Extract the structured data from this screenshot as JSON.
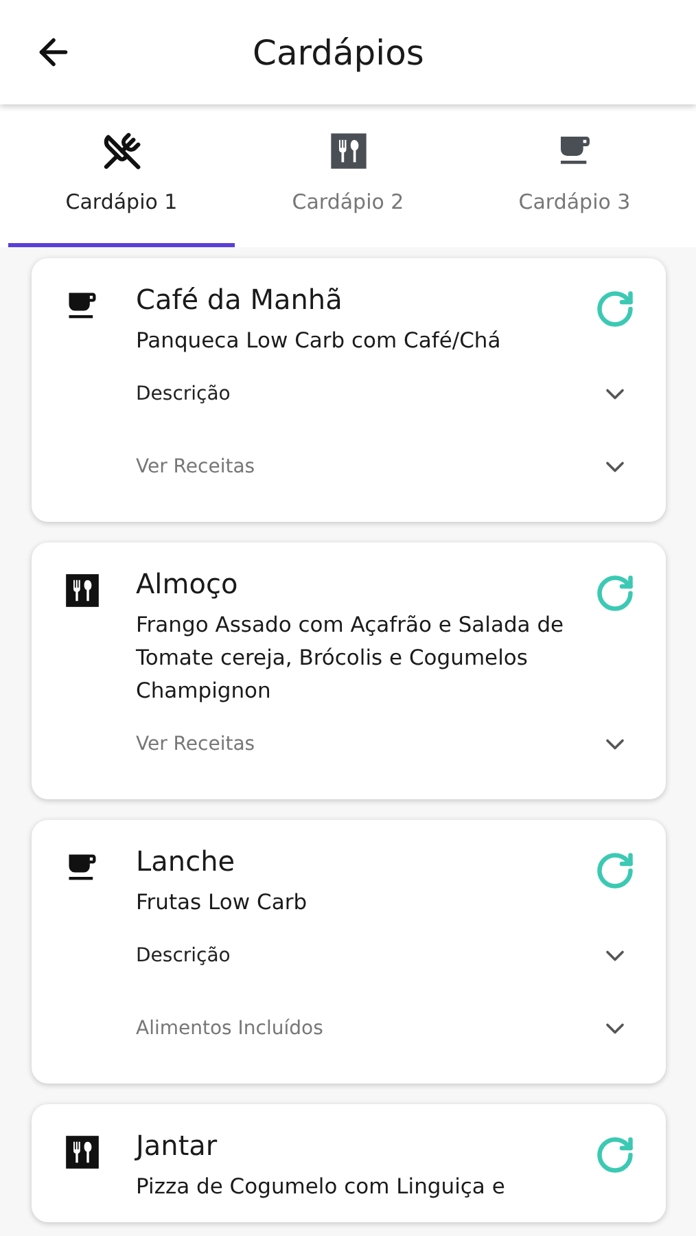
{
  "header": {
    "title": "Cardápios"
  },
  "tabs": [
    {
      "label": "Cardápio 1",
      "kind": "crossed",
      "selected": true
    },
    {
      "label": "Cardápio 2",
      "kind": "cutlery",
      "selected": false
    },
    {
      "label": "Cardápio 3",
      "kind": "cup",
      "selected": false
    }
  ],
  "meals": [
    {
      "kind": "cup",
      "title": "Café da Manhã",
      "dish": "Panqueca Low Carb com Café/Chá",
      "sections": [
        {
          "kind": "description",
          "label": "Descrição"
        },
        {
          "kind": "list",
          "label": "Ver Receitas"
        }
      ]
    },
    {
      "kind": "cutlery",
      "title": "Almoço",
      "dish": "Frango Assado com Açafrão e Salada de Tomate cereja, Brócolis e Cogumelos Champignon",
      "sections": [
        {
          "kind": "list",
          "label": "Ver Receitas"
        }
      ]
    },
    {
      "kind": "cup",
      "title": "Lanche",
      "dish": "Frutas Low Carb",
      "sections": [
        {
          "kind": "description",
          "label": "Descrição"
        },
        {
          "kind": "list",
          "label": "Alimentos Incluídos"
        }
      ]
    },
    {
      "kind": "cutlery",
      "title": "Jantar",
      "dish": "Pizza de Cogumelo com Linguiça e"
    }
  ]
}
